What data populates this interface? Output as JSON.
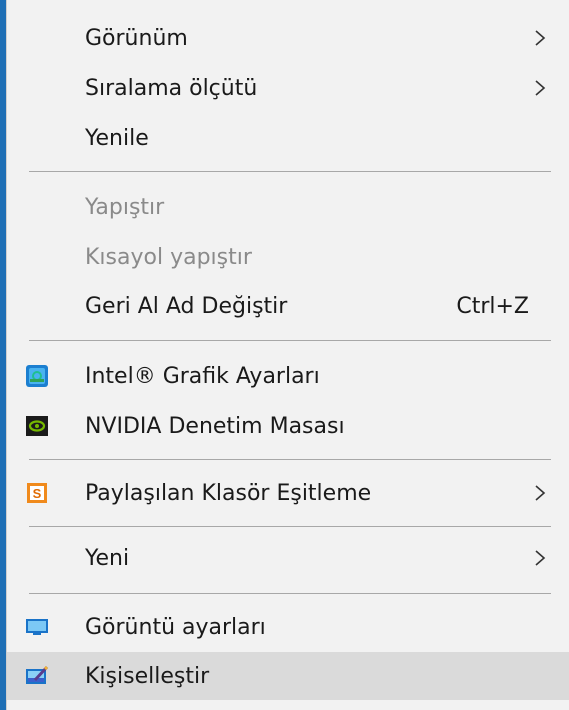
{
  "menu": {
    "view": {
      "label": "Görünüm"
    },
    "sort_by": {
      "label": "Sıralama ölçütü"
    },
    "refresh": {
      "label": "Yenile"
    },
    "paste": {
      "label": "Yapıştır"
    },
    "paste_shortcut": {
      "label": "Kısayol yapıştır"
    },
    "undo_rename": {
      "label": "Geri Al Ad Değiştir",
      "shortcut": "Ctrl+Z"
    },
    "intel_graphics": {
      "label": "Intel® Grafik Ayarları"
    },
    "nvidia_control_panel": {
      "label": "NVIDIA Denetim Masası"
    },
    "shared_folder_sync": {
      "label": "Paylaşılan Klasör Eşitleme"
    },
    "new": {
      "label": "Yeni"
    },
    "display_settings": {
      "label": "Görüntü ayarları"
    },
    "personalize": {
      "label": "Kişiselleştir"
    }
  },
  "colors": {
    "menu_background": "#f2f2f2",
    "hover_background": "#dadada",
    "disabled_text": "#8a8a8a",
    "desktop_edge": "#1f6fb5"
  }
}
